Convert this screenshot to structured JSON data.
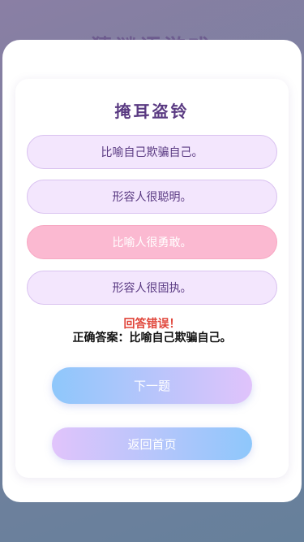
{
  "background": {
    "title": "猜谜语游戏"
  },
  "quiz": {
    "question": "掩耳盗铃",
    "options": [
      {
        "label": "比喻自己欺骗自己。",
        "state": "default"
      },
      {
        "label": "形容人很聪明。",
        "state": "default"
      },
      {
        "label": "比喻人很勇敢。",
        "state": "wrong-selected"
      },
      {
        "label": "形容人很固执。",
        "state": "default"
      }
    ],
    "result_text": "回答错误！",
    "correct_answer_text": "正确答案：比喻自己欺骗自己。"
  },
  "buttons": {
    "next_label": "下一题",
    "home_label": "返回首页"
  },
  "colors": {
    "option_bg": "#f3e6fd",
    "option_wrong_bg": "#fbb9d1",
    "question_text": "#5a3a82",
    "error_text": "#e0453a",
    "gradient_blue": "#8ec7fb",
    "gradient_purple": "#e0c3fb"
  }
}
